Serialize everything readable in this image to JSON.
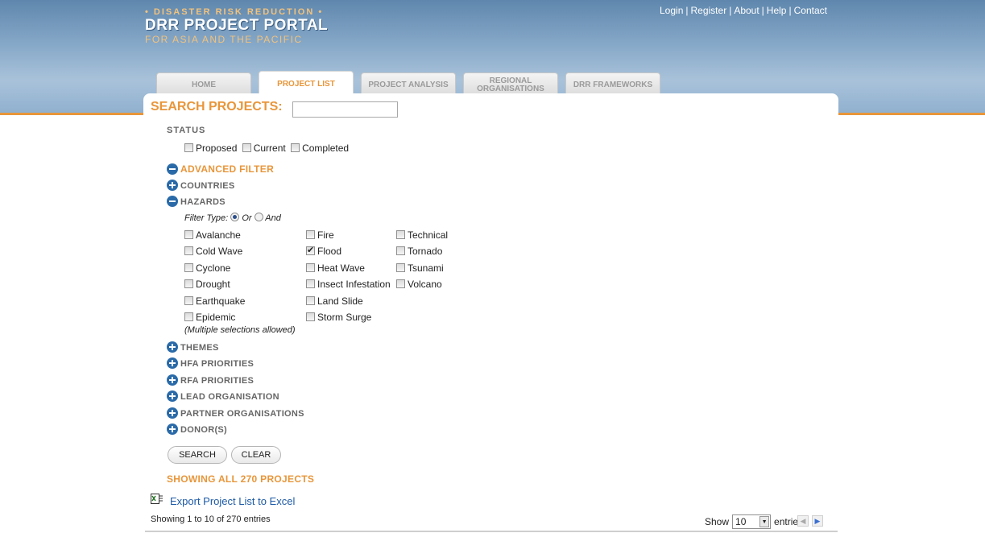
{
  "logo": {
    "tagline": "• DISASTER RISK REDUCTION •",
    "title": "DRR PROJECT PORTAL",
    "subtitle": "FOR ASIA AND THE PACIFIC"
  },
  "top_links": [
    "Login",
    "Register",
    "About",
    "Help",
    "Contact"
  ],
  "tabs": [
    {
      "label": "HOME",
      "active": false
    },
    {
      "label": "PROJECT LIST",
      "active": true
    },
    {
      "label": "PROJECT ANALYSIS",
      "active": false
    },
    {
      "label_line1": "REGIONAL",
      "label_line2": "ORGANISATIONS",
      "active": false
    },
    {
      "label": "DRR FRAMEWORKS",
      "active": false
    }
  ],
  "search": {
    "title": "SEARCH PROJECTS:",
    "value": ""
  },
  "status": {
    "label": "STATUS",
    "options": [
      {
        "label": "Proposed",
        "checked": false
      },
      {
        "label": "Current",
        "checked": false
      },
      {
        "label": "Completed",
        "checked": false
      }
    ]
  },
  "advanced_filter": "ADVANCED FILTER",
  "sections": {
    "countries": "COUNTRIES",
    "hazards": "HAZARDS",
    "themes": "THEMES",
    "hfa": "HFA PRIORITIES",
    "rfa": "RFA PRIORITIES",
    "lead_org": "LEAD ORGANISATION",
    "partner_orgs": "PARTNER ORGANISATIONS",
    "donors": "DONOR(S)"
  },
  "filter_type": {
    "label": "Filter Type:",
    "or": "Or",
    "and": "And",
    "selected": "Or"
  },
  "hazards": {
    "col1": [
      {
        "label": "Avalanche",
        "checked": false
      },
      {
        "label": "Cold Wave",
        "checked": false
      },
      {
        "label": "Cyclone",
        "checked": false
      },
      {
        "label": "Drought",
        "checked": false
      },
      {
        "label": "Earthquake",
        "checked": false
      },
      {
        "label": "Epidemic",
        "checked": false
      }
    ],
    "col2": [
      {
        "label": "Fire",
        "checked": false
      },
      {
        "label": "Flood",
        "checked": true
      },
      {
        "label": "Heat Wave",
        "checked": false
      },
      {
        "label": "Insect Infestation",
        "checked": false
      },
      {
        "label": "Land Slide",
        "checked": false
      },
      {
        "label": "Storm Surge",
        "checked": false
      }
    ],
    "col3": [
      {
        "label": "Technical",
        "checked": false
      },
      {
        "label": "Tornado",
        "checked": false
      },
      {
        "label": "Tsunami",
        "checked": false
      },
      {
        "label": "Volcano",
        "checked": false
      }
    ],
    "note": "(Multiple selections allowed)"
  },
  "buttons": {
    "search": "SEARCH",
    "clear": "CLEAR"
  },
  "showing_all": "SHOWING ALL 270 PROJECTS",
  "export_link": "Export Project List to Excel",
  "entries_info": "Showing 1 to 10 of 270 entries",
  "pagination": {
    "show_label": "Show",
    "show_value": "10",
    "entries_label": "entries"
  },
  "colors": {
    "accent": "#e8963a",
    "link": "#1d5aa6",
    "toggle": "#2a6aa8"
  }
}
